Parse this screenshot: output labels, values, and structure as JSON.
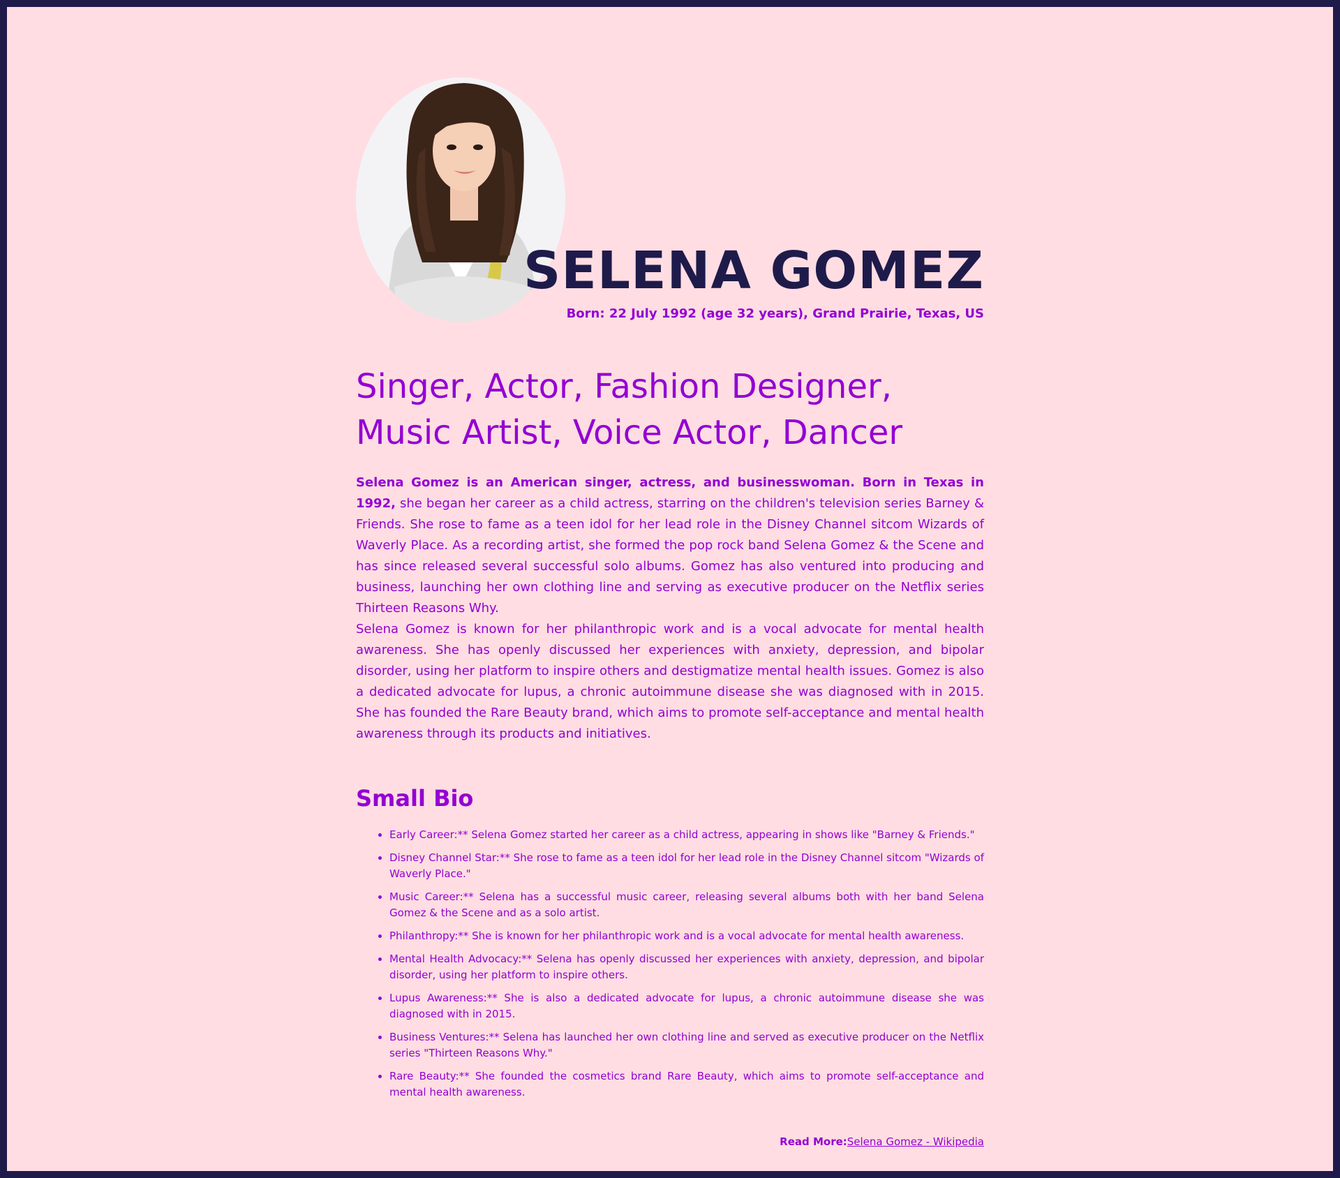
{
  "profile": {
    "name": "SELENA GOMEZ",
    "born": "Born: 22 July 1992 (age 32 years), Grand Prairie, Texas, US",
    "photo_icon": "portrait-photo"
  },
  "roles": "Singer, Actor, Fashion Designer, Music Artist, Voice Actor, Dancer",
  "intro": {
    "lead_bold": "Selena Gomez is an American singer, actress, and businesswoman. Born in Texas in 1992,",
    "lead_rest": " she began her career as a child actress, starring on the children's television series Barney & Friends. She rose to fame as a teen idol for her lead role in the Disney Channel sitcom Wizards of Waverly Place. As a recording artist, she formed the pop rock band Selena Gomez & the Scene and has since released several successful solo albums. Gomez has also ventured into producing and business, launching her own clothing line and serving as executive producer on the Netflix series Thirteen Reasons Why.",
    "second": "Selena Gomez is known for her philanthropic work and is a vocal advocate for mental health awareness. She has openly discussed her experiences with anxiety, depression, and bipolar disorder, using her platform to inspire others and destigmatize mental health issues. Gomez is also a dedicated advocate for lupus, a chronic autoimmune disease she was diagnosed with in 2015. She has founded the Rare Beauty brand, which aims to promote self-acceptance and mental health awareness through its products and initiatives."
  },
  "small_bio": {
    "title": "Small Bio",
    "items": [
      "Early Career:** Selena Gomez started her career as a child actress, appearing in shows like \"Barney & Friends.\"",
      "Disney Channel Star:** She rose to fame as a teen idol for her lead role in the Disney Channel sitcom \"Wizards of Waverly Place.\"",
      "Music Career:** Selena has a successful music career, releasing several albums both with her band Selena Gomez & the Scene and as a solo artist.",
      "Philanthropy:** She is known for her philanthropic work and is a vocal advocate for mental health awareness.",
      "Mental Health Advocacy:** Selena has openly discussed her experiences with anxiety, depression, and bipolar disorder, using her platform to inspire others.",
      "Lupus Awareness:** She is also a dedicated advocate for lupus, a chronic autoimmune disease she was diagnosed with in 2015.",
      "Business Ventures:** Selena has launched her own clothing line and served as executive producer on the Netflix series \"Thirteen Reasons Why.\"",
      "Rare Beauty:** She founded the cosmetics brand Rare Beauty, which aims to promote self-acceptance and mental health awareness."
    ]
  },
  "read_more": {
    "label": "Read More:",
    "link_text": "Selena Gomez - Wikipedia"
  },
  "colors": {
    "background": "#ffdde2",
    "frame": "#1e1b4b",
    "accent": "#9400d3",
    "name": "#1e1b4b"
  }
}
